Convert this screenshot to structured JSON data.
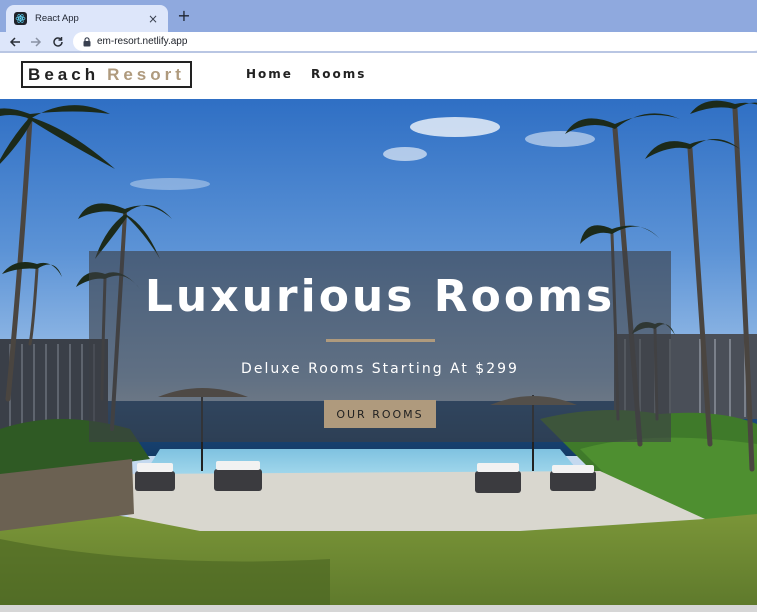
{
  "browser": {
    "tab_title": "React App",
    "tab_close": "×",
    "new_tab": "+",
    "url": "em-resort.netlify.app"
  },
  "site": {
    "logo_word1": "Beach",
    "logo_word2": "Resort",
    "nav_links": [
      "Home",
      "Rooms"
    ]
  },
  "hero": {
    "title": "Luxurious Rooms",
    "subtitle": "Deluxe Rooms Starting At $299",
    "button_label": "OUR ROOMS"
  },
  "colors": {
    "accent": "#af9a7d",
    "tab_bar": "#8fa9de",
    "toolbar": "#dde6fa",
    "banner_overlay": "rgba(60,63,70,0.62)"
  },
  "icons": [
    "react-favicon-icon",
    "close-icon",
    "plus-icon",
    "back-arrow-icon",
    "forward-arrow-icon",
    "reload-icon",
    "lock-icon"
  ]
}
